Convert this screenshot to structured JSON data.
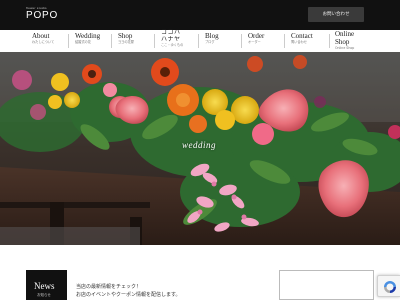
{
  "header": {
    "logo_small": "flower studio",
    "logo_main": "POPO",
    "contact_label": "お問い合わせ"
  },
  "nav": {
    "items": [
      {
        "en": "About",
        "ja": "わたしについて"
      },
      {
        "en": "Wedding",
        "ja": "結婚式の花"
      },
      {
        "en": "Shop",
        "ja": "ヨヨの花屋"
      },
      {
        "en": "ココハ\nハナヤ",
        "ja": "ここ・ゆくもの"
      },
      {
        "en": "Blog",
        "ja": "ブログ"
      },
      {
        "en": "Order",
        "ja": "オーダー"
      },
      {
        "en": "Contact",
        "ja": "問い合わせ"
      },
      {
        "en": "Online\nShop",
        "ja": "Online Shop"
      }
    ]
  },
  "hero": {
    "caption": "wedding"
  },
  "news": {
    "title_en": "News",
    "title_ja": "お知らせ",
    "line1": "当店の最新情報をチェック！",
    "line2": "お店のイベントやクーポン情報を配信します。"
  },
  "colors": {
    "header_bg": "#111111",
    "accent_pink": "#e8707a",
    "accent_orange": "#e85a1a",
    "accent_yellow": "#f0c020"
  }
}
